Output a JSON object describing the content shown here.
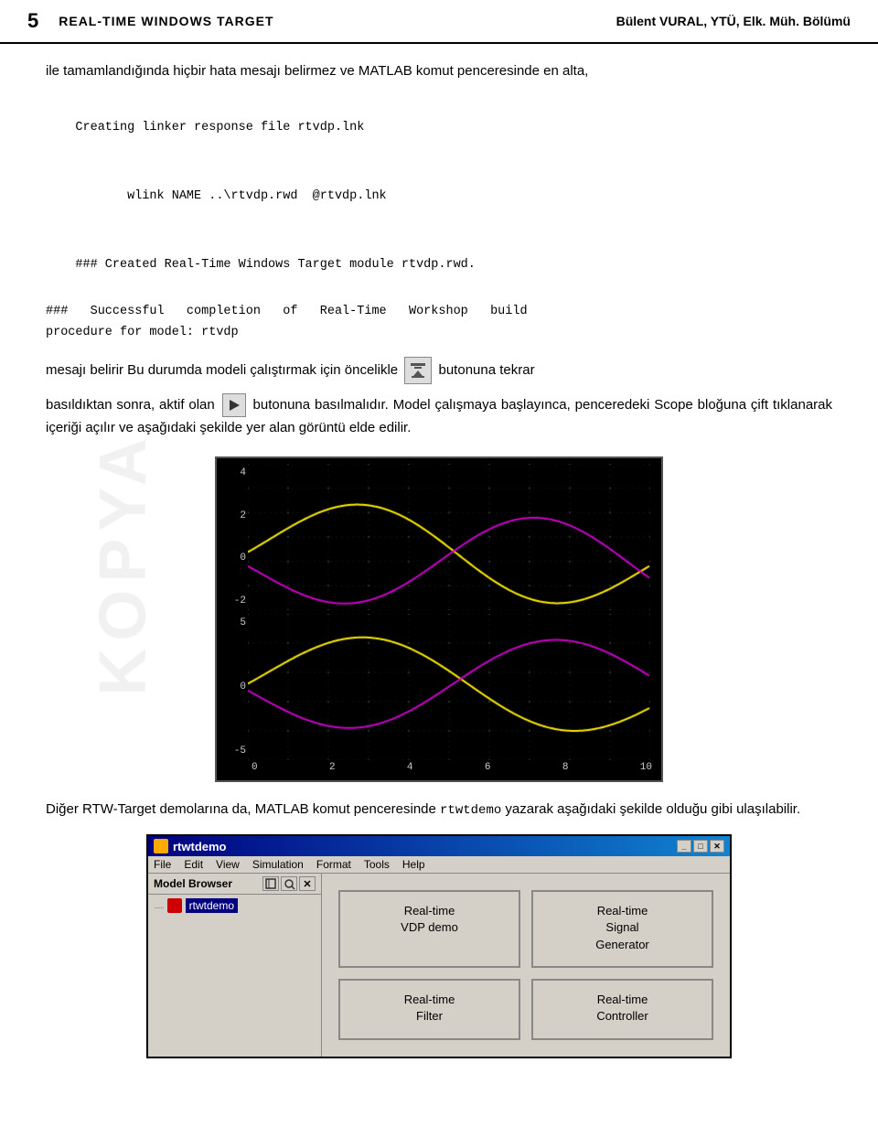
{
  "header": {
    "page_number": "5",
    "left_text": "REAL-TIME WINDOWS TARGET",
    "right_text": "Bülent VURAL, YTÜ, Elk. Müh. Bölümü"
  },
  "watermark": "KOPYA",
  "intro": {
    "text": "ile tamamlandığında hiçbir hata mesajı belirmez ve MATLAB komut penceresinde en alta,"
  },
  "code": {
    "line1": "Creating linker response file rtvdp.lnk",
    "line2": "       wlink NAME ..\\rtvdp.rwd  @rtvdp.lnk",
    "line3": "### Created Real-Time Windows Target module rtvdp.rwd.",
    "build_line": "###   Successful   completion   of   Real-Time   Workshop   build\nprocedure for model: rtvdp"
  },
  "paragraph1_before": "mesajı belirir Bu durumda modeli çalıştırmak için öncelikle",
  "paragraph1_after": "butonuna tekrar",
  "paragraph2_before": "basıldıktan sonra, aktif olan",
  "paragraph2_after": "butonuna basılmalıdır.",
  "paragraph3": "Model çalışmaya başlayınca, penceredeki Scope bloğuna çift tıklanarak içeriği açılır ve aşağıdaki şekilde yer alan görüntü elde edilir.",
  "scope": {
    "top_panel": {
      "y_max": "4",
      "y_mid": "2",
      "y_zero": "0",
      "y_neg2": "-2"
    },
    "bottom_panel": {
      "y_max": "5",
      "y_zero": "0",
      "y_neg5": "-5"
    },
    "x_labels": [
      "0",
      "2",
      "4",
      "6",
      "8",
      "10"
    ]
  },
  "bottom_text": "Diğer RTW-Target demolarına da, MATLAB komut penceresinde",
  "rtwtdemo_cmd": "rtwtdemo",
  "bottom_text2": "yazarak aşağıdaki şekilde olduğu gibi ulaşılabilir.",
  "rtwtdemo_window": {
    "title": "rtwtdemo",
    "menu_items": [
      "File",
      "Edit",
      "View",
      "Simulation",
      "Format",
      "Tools",
      "Help"
    ],
    "model_browser_label": "Model Browser",
    "tree_item": "rtwtdemo",
    "btn_minimize": "_",
    "btn_restore": "□",
    "btn_close": "✕",
    "buttons": [
      {
        "label": "Real-time\nVDP demo"
      },
      {
        "label": "Real-time\nSignal\nGenerator"
      },
      {
        "label": "Real-time\nFilter"
      },
      {
        "label": "Real-time\nController"
      }
    ]
  }
}
